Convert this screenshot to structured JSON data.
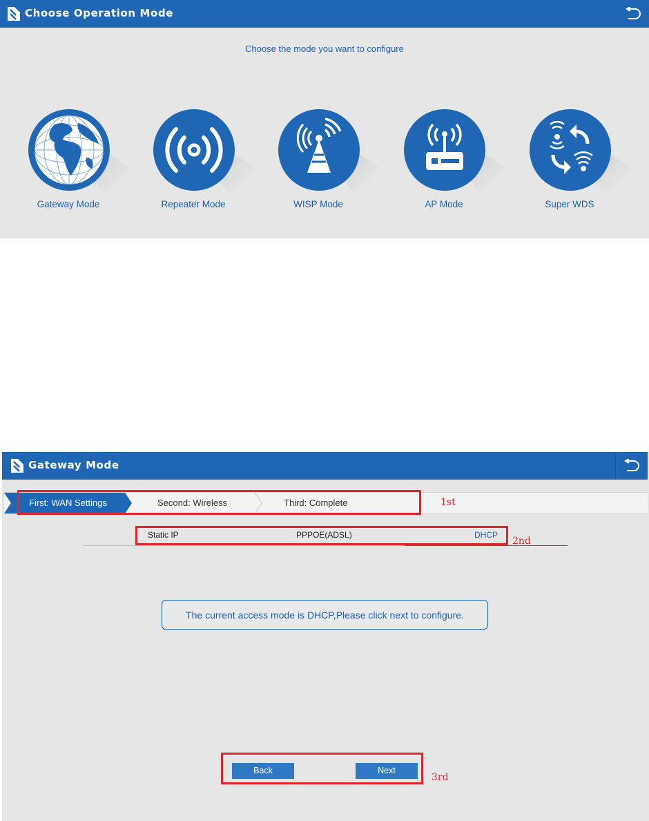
{
  "panel1": {
    "title": "Choose Operation Mode",
    "subtitle": "Choose the mode you want to configure",
    "modes": [
      {
        "label": "Gateway Mode",
        "icon": "globe-icon"
      },
      {
        "label": "Repeater Mode",
        "icon": "signal-waves-icon"
      },
      {
        "label": "WISP Mode",
        "icon": "antenna-tower-icon"
      },
      {
        "label": "AP Mode",
        "icon": "router-icon"
      },
      {
        "label": "Super WDS",
        "icon": "wds-exchange-icon"
      }
    ]
  },
  "panel2": {
    "title": "Gateway Mode",
    "steps": [
      "First: WAN Settings",
      "Second: Wireless",
      "Third: Complete"
    ],
    "tabs": {
      "static": "Static IP",
      "pppoe": "PPPOE(ADSL)",
      "dhcp": "DHCP"
    },
    "message": "The current access mode is DHCP,Please click next to configure.",
    "buttons": {
      "back": "Back",
      "next": "Next"
    },
    "annotations": {
      "first": "1st",
      "second": "2nd",
      "third": "3rd"
    }
  },
  "colors": {
    "brand_blue": "#1f66b4",
    "panel_bg": "#e6e6e6",
    "annotation_red": "#e0262d"
  }
}
